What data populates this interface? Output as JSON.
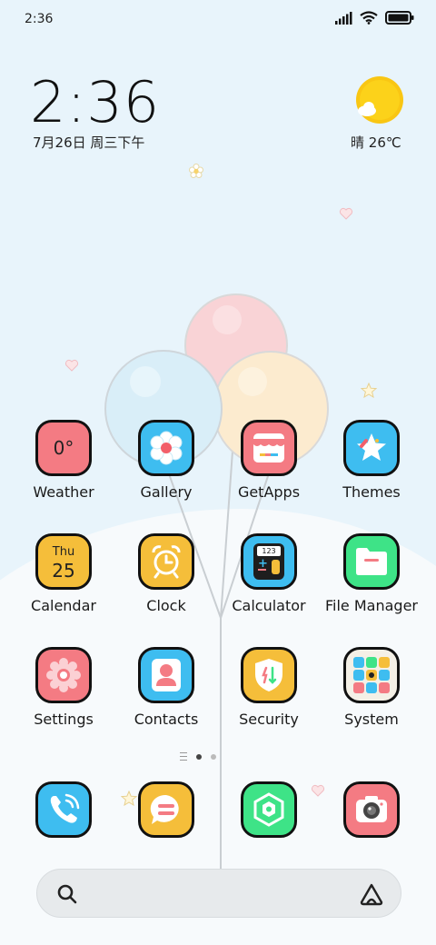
{
  "status_bar": {
    "time": "2:36"
  },
  "clock_widget": {
    "time": "2:36",
    "date": "7月26日 周三下午"
  },
  "weather_widget": {
    "condition": "晴",
    "temperature": "26℃"
  },
  "apps": [
    {
      "label": "Weather",
      "badge": "0°"
    },
    {
      "label": "Gallery"
    },
    {
      "label": "GetApps"
    },
    {
      "label": "Themes"
    },
    {
      "label": "Calendar",
      "day": "Thu",
      "date": "25"
    },
    {
      "label": "Clock"
    },
    {
      "label": "Calculator",
      "display": "123"
    },
    {
      "label": "File Manager"
    },
    {
      "label": "Settings"
    },
    {
      "label": "Contacts"
    },
    {
      "label": "Security"
    },
    {
      "label": "System"
    }
  ],
  "dock": [
    {
      "name": "phone-icon"
    },
    {
      "name": "messages-icon"
    },
    {
      "name": "mi-browser-icon"
    },
    {
      "name": "camera-icon"
    }
  ],
  "colors": {
    "red": "#f47b83",
    "blue": "#3ebdf0",
    "yellow": "#f5be3a",
    "green": "#3ee387"
  }
}
